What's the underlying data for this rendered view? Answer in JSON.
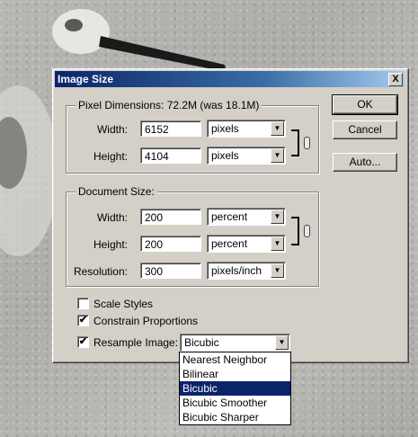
{
  "window": {
    "title": "Image Size",
    "close_glyph": "X"
  },
  "pixel_dimensions": {
    "legend": "Pixel Dimensions:  72.2M (was 18.1M)",
    "width_label": "Width:",
    "width_value": "6152",
    "width_unit": "pixels",
    "height_label": "Height:",
    "height_value": "4104",
    "height_unit": "pixels"
  },
  "document_size": {
    "legend": "Document Size:",
    "width_label": "Width:",
    "width_value": "200",
    "width_unit": "percent",
    "height_label": "Height:",
    "height_value": "200",
    "height_unit": "percent",
    "resolution_label": "Resolution:",
    "resolution_value": "300",
    "resolution_unit": "pixels/inch"
  },
  "options": {
    "scale_styles": {
      "label": "Scale Styles",
      "checked": false
    },
    "constrain_proportions": {
      "label": "Constrain Proportions",
      "checked": true
    },
    "resample_image": {
      "label": "Resample Image:",
      "checked": true,
      "method": "Bicubic"
    }
  },
  "buttons": {
    "ok": "OK",
    "cancel": "Cancel",
    "auto": "Auto..."
  },
  "resample_menu": {
    "options": [
      "Nearest Neighbor",
      "Bilinear",
      "Bicubic",
      "Bicubic Smoother",
      "Bicubic Sharper"
    ],
    "selected_index": 2
  },
  "icons": {
    "check": "✔",
    "arrow": "▼",
    "link": "chain-link-icon"
  }
}
